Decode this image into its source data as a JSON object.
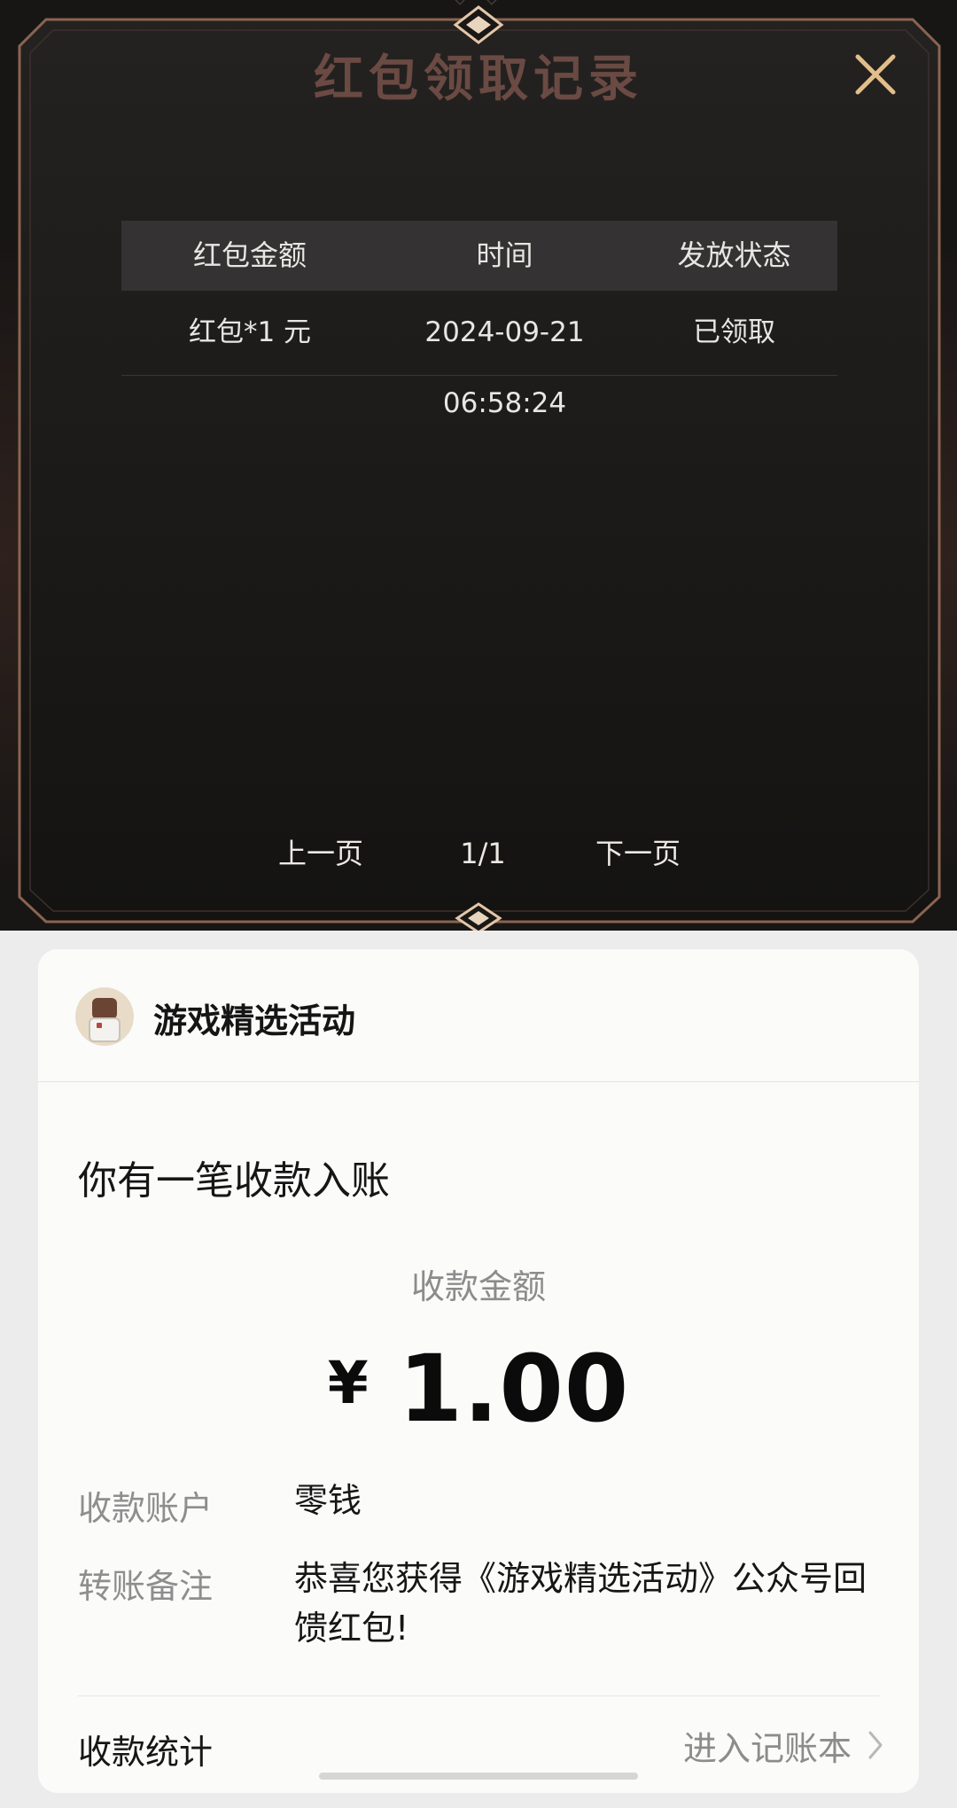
{
  "dialog": {
    "title": "红包领取记录",
    "close_icon": "close-icon",
    "columns": [
      "红包金额",
      "时间",
      "发放状态"
    ],
    "rows": [
      {
        "amount": "红包*1 元",
        "time": "2024-09-21 06:58:24",
        "status": "已领取"
      }
    ],
    "pager": {
      "prev": "上一页",
      "page": "1/1",
      "next": "下一页"
    }
  },
  "receipt": {
    "merchant": "游戏精选活动",
    "headline": "你有一笔收款入账",
    "amount_label": "收款金额",
    "currency": "¥",
    "amount": "1.00",
    "account_label": "收款账户",
    "account_value": "零钱",
    "note_label": "转账备注",
    "note_value": "恭喜您获得《游戏精选活动》公众号回馈红包!",
    "stats_label": "收款统计",
    "ledger_link": "进入记账本"
  },
  "colors": {
    "dialog_bg": "#181615",
    "dialog_frame": "#b07b5a",
    "title": "#6a4a43",
    "close": "#e2be8a",
    "card_bg": "#fbfbfa"
  }
}
